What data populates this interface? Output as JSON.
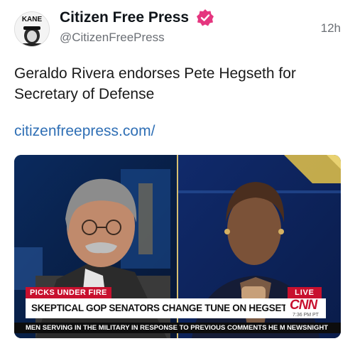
{
  "post": {
    "author_name": "Citizen Free Press",
    "handle": "@CitizenFreePress",
    "timestamp": "12h",
    "text": "Geraldo Rivera endorses Pete Hegseth for Secretary of Defense",
    "link_text": "citizenfreepress.com/",
    "avatar_text": "KANE",
    "verified_icon": "verified-badge-icon",
    "colors": {
      "verified": "#e5367f",
      "link": "#2f6fb5",
      "handle": "#6b6f75"
    }
  },
  "media": {
    "chyron_label": "PICKS UNDER FIRE",
    "live_label": "LIVE",
    "headline": "SKEPTICAL GOP SENATORS CHANGE TUNE ON HEGSETH AMID PRESSURE",
    "network": "CNN",
    "network_time": "7:36 PM PT",
    "ticker": "MEN SERVING IN THE MILITARY IN RESPONSE TO PREVIOUS COMMENTS HE MADE IN V",
    "ticker_tag": "NEWSNIGHT",
    "colors": {
      "network_red": "#c8102e",
      "studio_blue": "#0b1a3a"
    }
  }
}
